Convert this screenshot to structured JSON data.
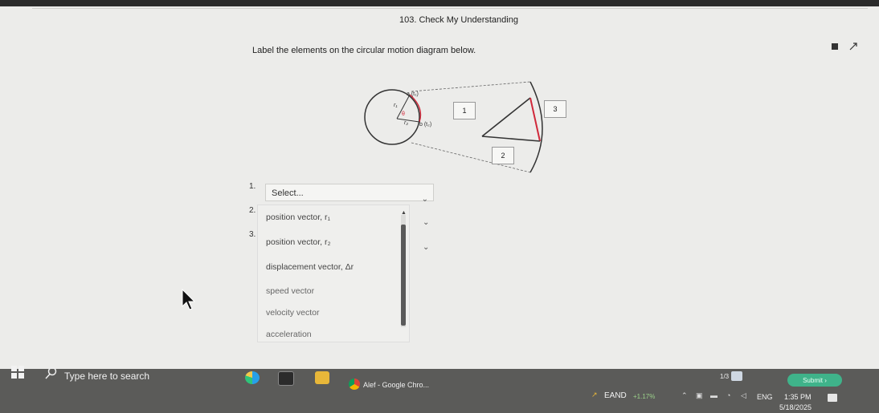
{
  "question": {
    "title": "103. Check My Understanding",
    "instruction": "Label the elements on the circular motion diagram below."
  },
  "diagram": {
    "labels": {
      "a_t1": "a (t₁)",
      "r1": "r₁",
      "r2": "r₂",
      "b_t2": "b (t₂)",
      "theta": "θ"
    },
    "boxes": [
      "1",
      "3",
      "2"
    ],
    "colors": {
      "circle": "#333333",
      "arc_red": "#d0283a",
      "triangle_red": "#d0283a"
    }
  },
  "answers": {
    "numbers": [
      "1.",
      "2.",
      "3."
    ],
    "select1_placeholder": "Select..."
  },
  "dropdown": {
    "options": [
      "position vector, r₁",
      "position vector, r₂",
      "displacement vector, Δr",
      "speed vector",
      "velocity vector",
      "acceleration"
    ]
  },
  "footer": {
    "page_count": "1/3",
    "submit_label": "Submit ›",
    "accent_color": "#3fb38a"
  },
  "taskbar": {
    "search_placeholder": "Type here to search",
    "chrome_label": "Alef - Google Chro...",
    "stock_label": "EAND",
    "stock_change": "+1.17%",
    "language": "ENG",
    "time": "1:35 PM",
    "date": "5/18/2025"
  }
}
